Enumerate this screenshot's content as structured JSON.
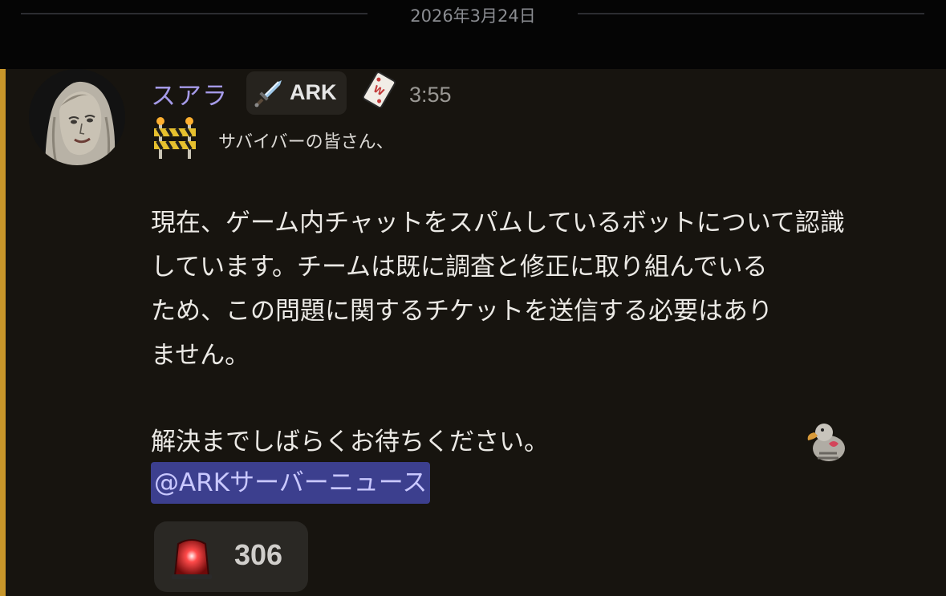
{
  "date_divider": "2026年3月24日",
  "message": {
    "author": "スアラ",
    "role_tag": "ARK",
    "timestamp": "3:55",
    "greeting": "サバイバーの皆さん、",
    "body_lines": [
      "現在、ゲーム内チャットをスパムしているボットについて認識",
      "しています。チームは既に調査と修正に取り組んでいる",
      "ため、この問題に関するチケットを送信する必要はあり",
      "ません。"
    ],
    "closing": "解決までしばらくお待ちください。",
    "mention": "@ARKサーバーニュース",
    "icons": {
      "role_tag_icon": "sword-icon",
      "author_emoji": "playing-card-icon",
      "greeting_emoji": "construction-barrier-icon",
      "closing_emoji": "dodo-hug-icon",
      "reaction_emoji": "red-siren-icon"
    }
  },
  "reaction": {
    "count": "306"
  },
  "colors": {
    "username": "#a59ae8",
    "mention_highlight": "#3c3f8e",
    "mention_bar": "#c8962a"
  }
}
